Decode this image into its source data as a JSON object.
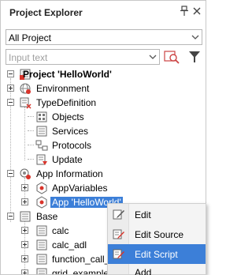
{
  "panel": {
    "title": "Project Explorer",
    "pin_icon": "pin-icon",
    "close_icon": "close-icon"
  },
  "scope_select": {
    "value": "All Project"
  },
  "search": {
    "placeholder": "Input text"
  },
  "tree": {
    "root": "Project 'HelloWorld'",
    "environment": "Environment",
    "type_definition": "TypeDefinition",
    "objects": "Objects",
    "services": "Services",
    "protocols": "Protocols",
    "update": "Update",
    "app_information": "App Information",
    "app_variables": "AppVariables",
    "app_helloworld": "App 'HelloWorld'",
    "base": "Base",
    "calc": "calc",
    "calc_adl": "calc_adl",
    "function_call": "function_call_",
    "grid_example": "grid_example"
  },
  "context_menu": {
    "items": [
      "Edit",
      "Edit Source",
      "Edit Script",
      "Add"
    ],
    "highlighted": "Edit Script"
  },
  "colors": {
    "selection": "#3c7fd8",
    "accent_red": "#d9342b"
  }
}
